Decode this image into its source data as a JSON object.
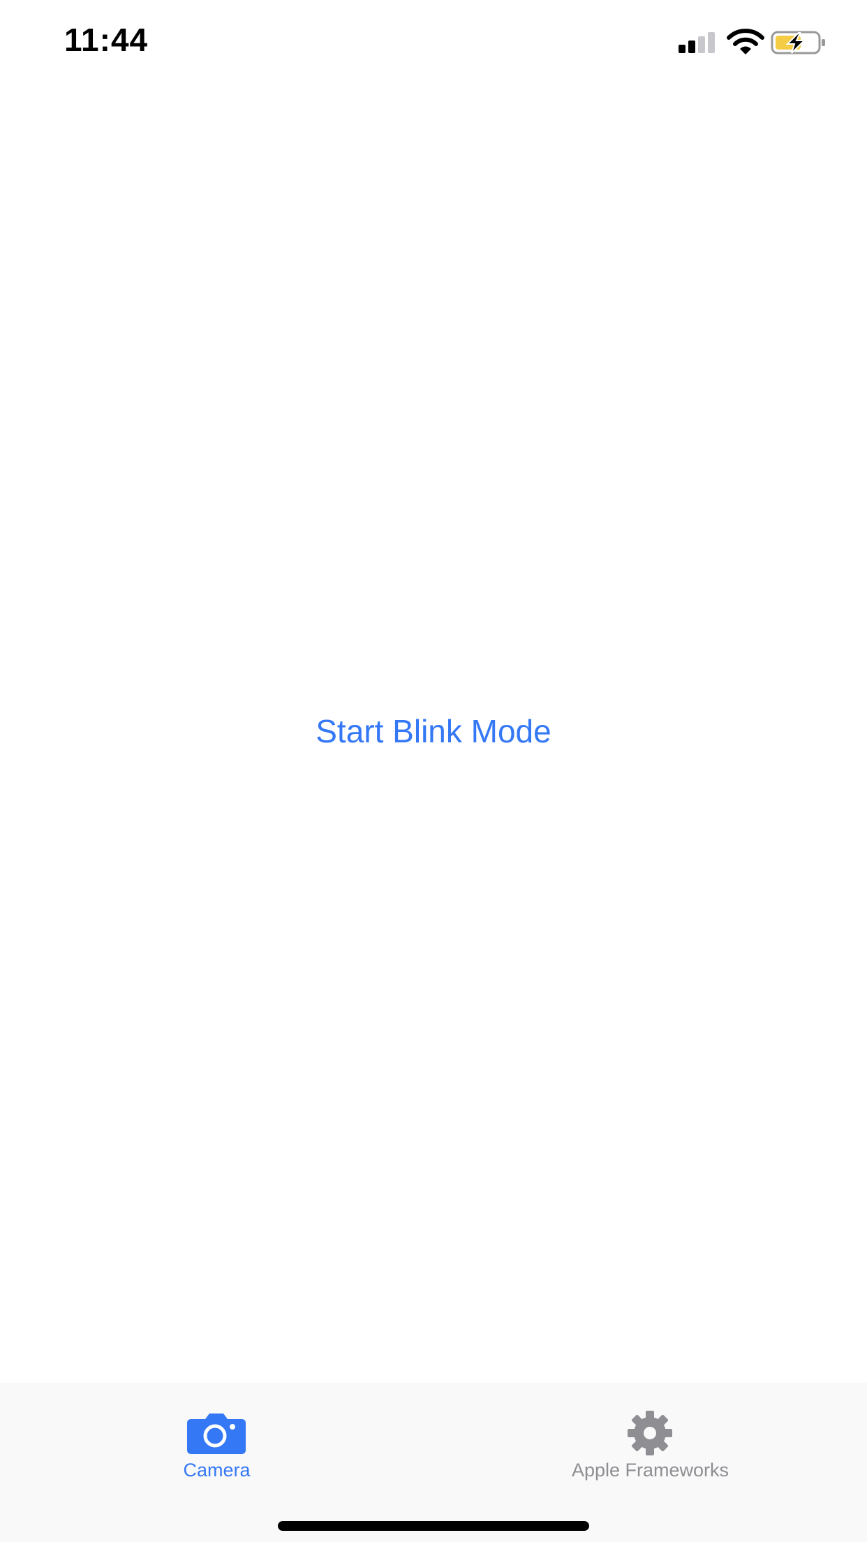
{
  "status_bar": {
    "time": "11:44",
    "signal_icon": "cellular-signal-icon",
    "wifi_icon": "wifi-icon",
    "battery_icon": "battery-charging-icon",
    "battery_color": "#f5cc45"
  },
  "main": {
    "start_button_label": "Start Blink Mode"
  },
  "tab_bar": {
    "tabs": [
      {
        "label": "Camera",
        "icon": "camera-icon",
        "selected": true
      },
      {
        "label": "Apple Frameworks",
        "icon": "gear-icon",
        "selected": false
      }
    ]
  },
  "colors": {
    "accent": "#3478f6",
    "inactive": "#8e8e93",
    "background": "#ffffff"
  }
}
